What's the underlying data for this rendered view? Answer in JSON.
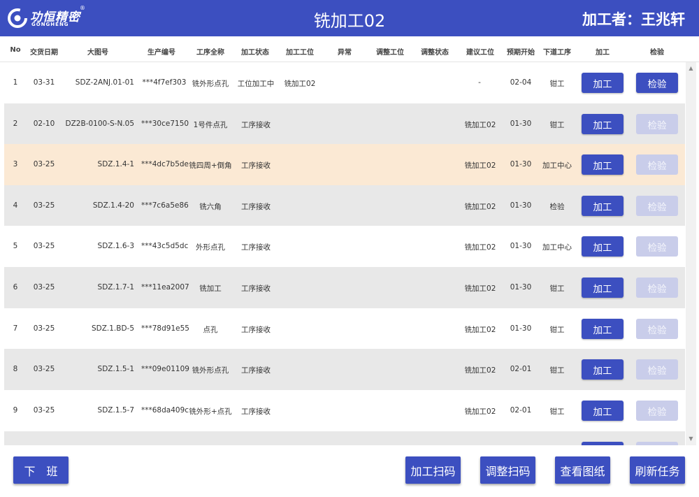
{
  "header": {
    "logo_cn": "功恒精密",
    "logo_en": "GONGHENG",
    "logo_reg": "®",
    "title": "铣加工02",
    "operator": "加工者：王兆轩"
  },
  "columns": [
    "No",
    "交货日期",
    "大图号",
    "生产编号",
    "工序全称",
    "加工状态",
    "加工工位",
    "异常",
    "调整工位",
    "调整状态",
    "建议工位",
    "预期开始",
    "下道工序",
    "加工",
    "检验"
  ],
  "rows": [
    {
      "no": "1",
      "date": "03-31",
      "drawing": "SDZ-2ANJ.01-01",
      "prod": "***4f7ef303",
      "process": "铣外形点孔",
      "status": "工位加工中",
      "station": "铣加工02",
      "exception": "",
      "adj_station": "",
      "adj_status": "",
      "suggest": "",
      "start": "-",
      "start2": "02-04",
      "next": "钳工",
      "btn_proc": "加工",
      "btn_insp": "检验",
      "insp_active": true,
      "style": "white"
    },
    {
      "no": "2",
      "date": "02-10",
      "drawing": "DZ2B-0100-S-N.05",
      "prod": "***30ce7150",
      "process": "1号件点孔",
      "status": "工序接收",
      "station": "",
      "exception": "",
      "adj_station": "",
      "adj_status": "",
      "suggest": "铣加工02",
      "start": "",
      "start2": "01-30",
      "next": "钳工",
      "btn_proc": "加工",
      "btn_insp": "检验",
      "insp_active": false,
      "style": "gray"
    },
    {
      "no": "3",
      "date": "03-25",
      "drawing": "SDZ.1.4-1",
      "prod": "***4dc7b5de",
      "process": "铣四周+倒角",
      "status": "工序接收",
      "station": "",
      "exception": "",
      "adj_station": "",
      "adj_status": "",
      "suggest": "铣加工02",
      "start": "",
      "start2": "01-30",
      "next": "加工中心",
      "btn_proc": "加工",
      "btn_insp": "检验",
      "insp_active": false,
      "style": "highlight"
    },
    {
      "no": "4",
      "date": "03-25",
      "drawing": "SDZ.1.4-20",
      "prod": "***7c6a5e86",
      "process": "铣六角",
      "status": "工序接收",
      "station": "",
      "exception": "",
      "adj_station": "",
      "adj_status": "",
      "suggest": "铣加工02",
      "start": "",
      "start2": "01-30",
      "next": "检验",
      "btn_proc": "加工",
      "btn_insp": "检验",
      "insp_active": false,
      "style": "gray"
    },
    {
      "no": "5",
      "date": "03-25",
      "drawing": "SDZ.1.6-3",
      "prod": "***43c5d5dc",
      "process": "外形点孔",
      "status": "工序接收",
      "station": "",
      "exception": "",
      "adj_station": "",
      "adj_status": "",
      "suggest": "铣加工02",
      "start": "",
      "start2": "01-30",
      "next": "加工中心",
      "btn_proc": "加工",
      "btn_insp": "检验",
      "insp_active": false,
      "style": "white"
    },
    {
      "no": "6",
      "date": "03-25",
      "drawing": "SDZ.1.7-1",
      "prod": "***11ea2007",
      "process": "铣加工",
      "status": "工序接收",
      "station": "",
      "exception": "",
      "adj_station": "",
      "adj_status": "",
      "suggest": "铣加工02",
      "start": "",
      "start2": "01-30",
      "next": "钳工",
      "btn_proc": "加工",
      "btn_insp": "检验",
      "insp_active": false,
      "style": "gray"
    },
    {
      "no": "7",
      "date": "03-25",
      "drawing": "SDZ.1.BD-5",
      "prod": "***78d91e55",
      "process": "点孔",
      "status": "工序接收",
      "station": "",
      "exception": "",
      "adj_station": "",
      "adj_status": "",
      "suggest": "铣加工02",
      "start": "",
      "start2": "01-30",
      "next": "钳工",
      "btn_proc": "加工",
      "btn_insp": "检验",
      "insp_active": false,
      "style": "white"
    },
    {
      "no": "8",
      "date": "03-25",
      "drawing": "SDZ.1.5-1",
      "prod": "***09e01109",
      "process": "铣外形点孔",
      "status": "工序接收",
      "station": "",
      "exception": "",
      "adj_station": "",
      "adj_status": "",
      "suggest": "铣加工02",
      "start": "",
      "start2": "02-01",
      "next": "钳工",
      "btn_proc": "加工",
      "btn_insp": "检验",
      "insp_active": false,
      "style": "gray"
    },
    {
      "no": "9",
      "date": "03-25",
      "drawing": "SDZ.1.5-7",
      "prod": "***68da409c",
      "process": "铣外形+点孔",
      "status": "工序接收",
      "station": "",
      "exception": "",
      "adj_station": "",
      "adj_status": "",
      "suggest": "铣加工02",
      "start": "",
      "start2": "02-01",
      "next": "钳工",
      "btn_proc": "加工",
      "btn_insp": "检验",
      "insp_active": false,
      "style": "white"
    },
    {
      "no": "",
      "date": "",
      "drawing": "",
      "prod": "",
      "process": "",
      "status": "",
      "station": "",
      "exception": "",
      "adj_station": "",
      "adj_status": "",
      "suggest": "",
      "start": "",
      "start2": "",
      "next": "",
      "btn_proc": "",
      "btn_insp": "",
      "insp_active": false,
      "style": "gray"
    }
  ],
  "footer": {
    "off_work": "下　班",
    "scan_process": "加工扫码",
    "scan_adjust": "调整扫码",
    "view_drawing": "查看图纸",
    "refresh": "刷新任务"
  },
  "scrollbar": {
    "up": "▲",
    "down": "▼"
  },
  "colors": {
    "brand": "#3c4fc0",
    "highlight_row": "#fbe9d4",
    "gray_row": "#e8e8e8",
    "disabled_button": "#c9cdea"
  }
}
